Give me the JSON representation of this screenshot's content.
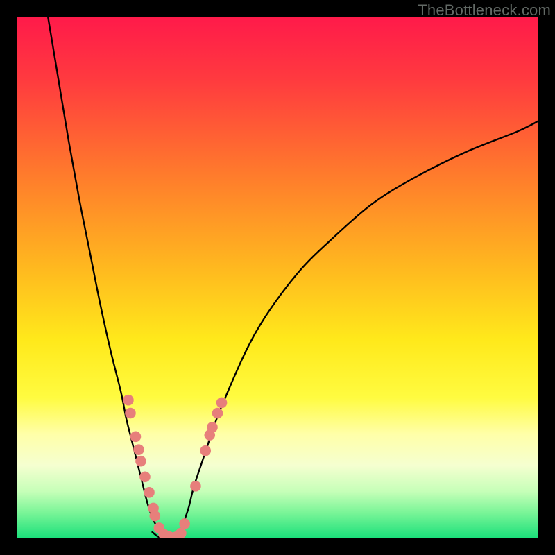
{
  "watermark": "TheBottleneck.com",
  "chart_data": {
    "type": "line",
    "title": "",
    "xlabel": "",
    "ylabel": "",
    "xlim": [
      0,
      100
    ],
    "ylim": [
      0,
      100
    ],
    "grid": false,
    "legend": false,
    "gradient_stops": [
      {
        "pos": 0.0,
        "color": "#ff1a4a"
      },
      {
        "pos": 0.12,
        "color": "#ff3a3f"
      },
      {
        "pos": 0.3,
        "color": "#ff7a2c"
      },
      {
        "pos": 0.48,
        "color": "#ffb81f"
      },
      {
        "pos": 0.62,
        "color": "#ffe91b"
      },
      {
        "pos": 0.73,
        "color": "#fffb40"
      },
      {
        "pos": 0.8,
        "color": "#ffffa8"
      },
      {
        "pos": 0.86,
        "color": "#f5ffd0"
      },
      {
        "pos": 0.91,
        "color": "#c6ffb8"
      },
      {
        "pos": 0.95,
        "color": "#7bf598"
      },
      {
        "pos": 1.0,
        "color": "#19e07a"
      }
    ],
    "series": [
      {
        "name": "left-curve",
        "x": [
          6,
          8,
          10,
          12,
          14,
          16,
          18,
          20,
          21,
          22,
          23,
          24,
          25,
          26,
          27,
          28
        ],
        "y": [
          100,
          88,
          76,
          65,
          55,
          45,
          36,
          28,
          23,
          19,
          15,
          11,
          7,
          4,
          2,
          0
        ]
      },
      {
        "name": "right-curve",
        "x": [
          31,
          32,
          33,
          34,
          36,
          38,
          40,
          44,
          48,
          54,
          60,
          68,
          76,
          86,
          96,
          100
        ],
        "y": [
          0,
          3,
          6,
          10,
          16,
          22,
          27,
          36,
          43,
          51,
          57,
          64,
          69,
          74,
          78,
          80
        ]
      },
      {
        "name": "valley-floor",
        "x": [
          26,
          27,
          28,
          29,
          30,
          31,
          32
        ],
        "y": [
          1.2,
          0.4,
          0.0,
          0.0,
          0.0,
          0.3,
          1.0
        ]
      }
    ],
    "markers": {
      "name": "scatter-dots",
      "color": "#e77f7b",
      "points": [
        {
          "x": 21.4,
          "y": 26.5
        },
        {
          "x": 21.8,
          "y": 24.0
        },
        {
          "x": 22.8,
          "y": 19.5
        },
        {
          "x": 23.4,
          "y": 17.0
        },
        {
          "x": 23.8,
          "y": 14.8
        },
        {
          "x": 24.6,
          "y": 11.8
        },
        {
          "x": 25.4,
          "y": 8.8
        },
        {
          "x": 26.2,
          "y": 5.8
        },
        {
          "x": 26.5,
          "y": 4.3
        },
        {
          "x": 27.3,
          "y": 2.0
        },
        {
          "x": 28.2,
          "y": 0.8
        },
        {
          "x": 29.3,
          "y": 0.3
        },
        {
          "x": 30.6,
          "y": 0.3
        },
        {
          "x": 31.5,
          "y": 1.0
        },
        {
          "x": 32.2,
          "y": 2.8
        },
        {
          "x": 34.3,
          "y": 10.0
        },
        {
          "x": 36.2,
          "y": 16.8
        },
        {
          "x": 37.0,
          "y": 19.8
        },
        {
          "x": 37.5,
          "y": 21.3
        },
        {
          "x": 38.5,
          "y": 24.0
        },
        {
          "x": 39.3,
          "y": 26.0
        }
      ]
    }
  }
}
